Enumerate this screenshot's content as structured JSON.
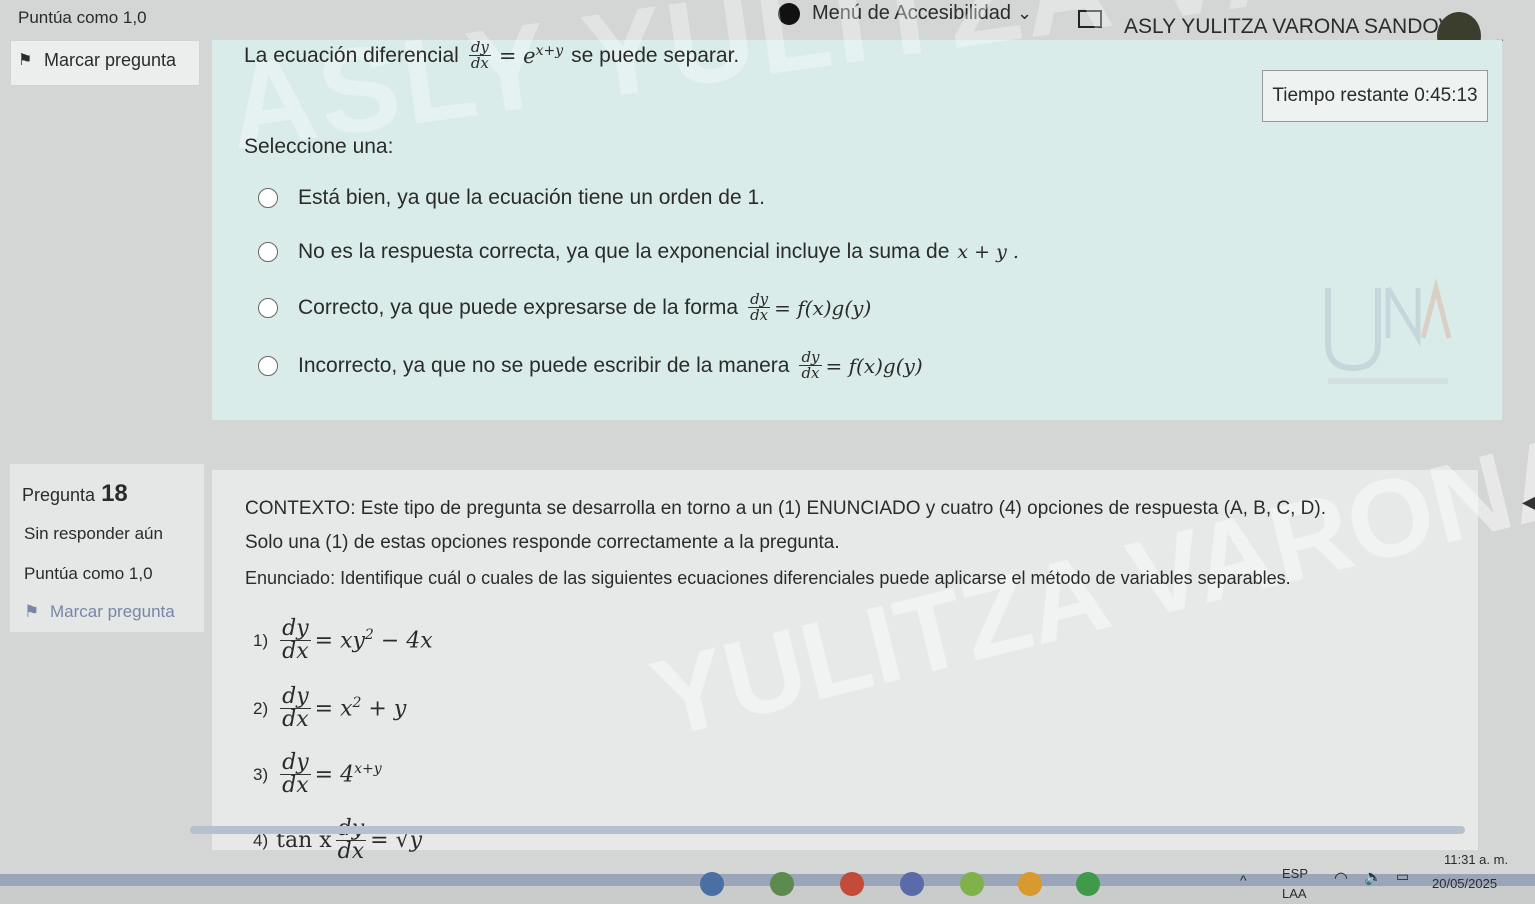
{
  "header": {
    "top_score": "Puntúa como 1,0",
    "accessibility_menu": "Menú de Accesibilidad",
    "accessibility_chevron": "⌄",
    "user_name": "ASLY YULITZA VARONA SANDOVAL",
    "user_chevron": "⌄"
  },
  "q17": {
    "flag_glyph": "⚑",
    "mark_label": "Marcar pregunta",
    "text_before": "La ecuación diferencial",
    "eq_num": "dy",
    "eq_den": "dx",
    "eq_rhs": "= e",
    "eq_exp": "x+y",
    "text_after": "se puede separar.",
    "timer_label": "Tiempo restante 0:45:13",
    "select_label": "Seleccione una:",
    "options": [
      {
        "text": "Está bien, ya que la ecuación tiene un orden de 1.",
        "math": ""
      },
      {
        "text": "No es la respuesta correcta, ya que la exponencial incluye la suma de",
        "math": "x + y ."
      },
      {
        "text": "Correcto, ya que puede expresarse de la forma",
        "num": "dy",
        "den": "dx",
        "rhs": "= f(x)g(y)"
      },
      {
        "text": "Incorrecto, ya que no se puede escribir de la manera",
        "num": "dy",
        "den": "dx",
        "rhs": "= f(x)g(y)"
      }
    ]
  },
  "q18": {
    "label": "Pregunta",
    "number": "18",
    "status": "Sin responder aún",
    "score": "Puntúa como 1,0",
    "flag_glyph": "⚑",
    "mark_label": "Marcar pregunta",
    "context": "CONTEXTO: Este tipo de pregunta se desarrolla en torno a un (1) ENUNCIADO y cuatro (4) opciones de respuesta (A, B, C, D).",
    "only_one": "Solo una (1) de estas opciones responde correctamente a la pregunta.",
    "statement": "Enunciado: Identifique cuál o cuales de las siguientes ecuaciones diferenciales puede aplicarse el método de variables separables.",
    "equations": [
      {
        "idx": "1)",
        "pre": "",
        "num": "dy",
        "den": "dx",
        "rhs": "= xy",
        "sup": "2",
        "tail": " − 4x"
      },
      {
        "idx": "2)",
        "pre": "",
        "num": "dy",
        "den": "dx",
        "rhs": "= x",
        "sup": "2",
        "tail": " + y"
      },
      {
        "idx": "3)",
        "pre": "",
        "num": "dy",
        "den": "dx",
        "rhs": "= 4",
        "sup": "x+y",
        "tail": ""
      },
      {
        "idx": "4)",
        "pre": "tan x",
        "num": "dy",
        "den": "dx",
        "rhs": "= √y",
        "sup": "",
        "tail": ""
      }
    ]
  },
  "taskbar": {
    "caret": "^",
    "lang1": "ESP",
    "lang2": "LAA",
    "wifi": "◠",
    "volume": "🔈",
    "battery": "▭",
    "time": "11:31 a. m.",
    "date": "20/05/2025"
  },
  "colors": {
    "q17_panel": "#d9ecea",
    "q18_panel": "#e6e9e8",
    "sidebar_info": "#ebeeed"
  }
}
